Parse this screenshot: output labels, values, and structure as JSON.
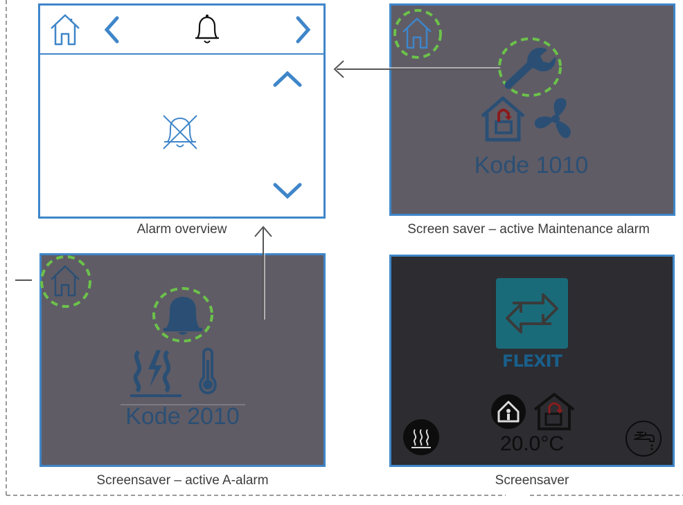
{
  "panels": {
    "alarm_overview": {
      "caption": "Alarm overview"
    },
    "maintenance": {
      "caption": "Screen saver – active Maintenance alarm",
      "code": "Kode 1010"
    },
    "a_alarm": {
      "caption": "Screensaver – active A-alarm",
      "code": "Kode 2010"
    },
    "screensaver": {
      "caption": "Screensaver",
      "brand": "FLEXIT",
      "temperature": "20.0°C"
    }
  },
  "colors": {
    "frame_blue": "#3f86c9",
    "highlight_green": "#6cc24a",
    "icon_dark_blue": "#2b4f74",
    "brand_teal": "#1a6b7a",
    "alert_red": "#8a1c1c"
  }
}
